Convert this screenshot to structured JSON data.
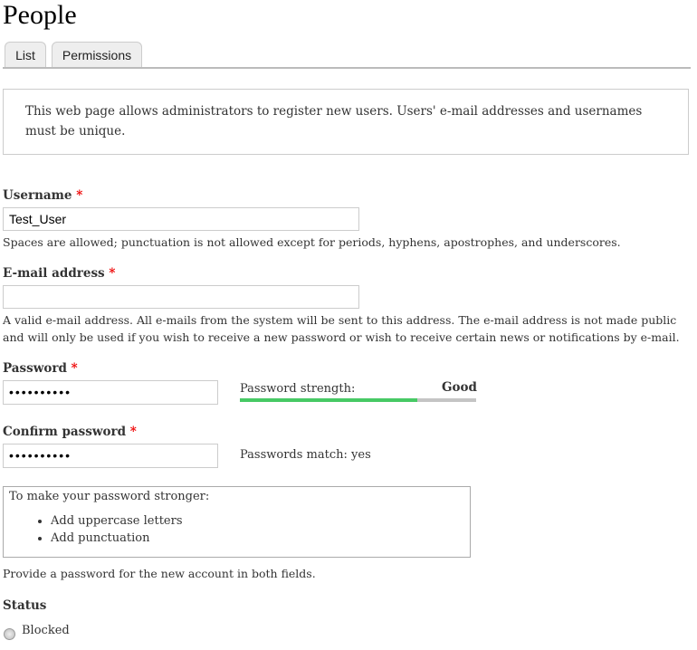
{
  "page": {
    "title": "People"
  },
  "tabs": [
    {
      "label": "List"
    },
    {
      "label": "Permissions"
    }
  ],
  "help_text": "This web page allows administrators to register new users. Users' e-mail addresses and usernames must be unique.",
  "form": {
    "required_marker": "*",
    "username": {
      "label": "Username",
      "value": "Test_User",
      "description": "Spaces are allowed; punctuation is not allowed except for periods, hyphens, apostrophes, and underscores."
    },
    "email": {
      "label": "E-mail address",
      "value": "",
      "description": "A valid e-mail address. All e-mails from the system will be sent to this address. The e-mail address is not made public and will only be used if you wish to receive a new password or wish to receive certain news or notifications by e-mail."
    },
    "password": {
      "label": "Password",
      "value": "••••••••••",
      "strength_label": "Password strength:",
      "strength_value": "Good",
      "strength_percent": 75,
      "strength_color": "#47c965"
    },
    "confirm_password": {
      "label": "Confirm password",
      "value": "••••••••••",
      "match_label": "Passwords match:",
      "match_value": "yes"
    },
    "suggestions": {
      "title": "To make your password stronger:",
      "items": [
        "Add uppercase letters",
        "Add punctuation"
      ]
    },
    "password_description": "Provide a password for the new account in both fields.",
    "status": {
      "label": "Status",
      "options": [
        {
          "label": "Blocked",
          "selected": false
        }
      ]
    }
  }
}
